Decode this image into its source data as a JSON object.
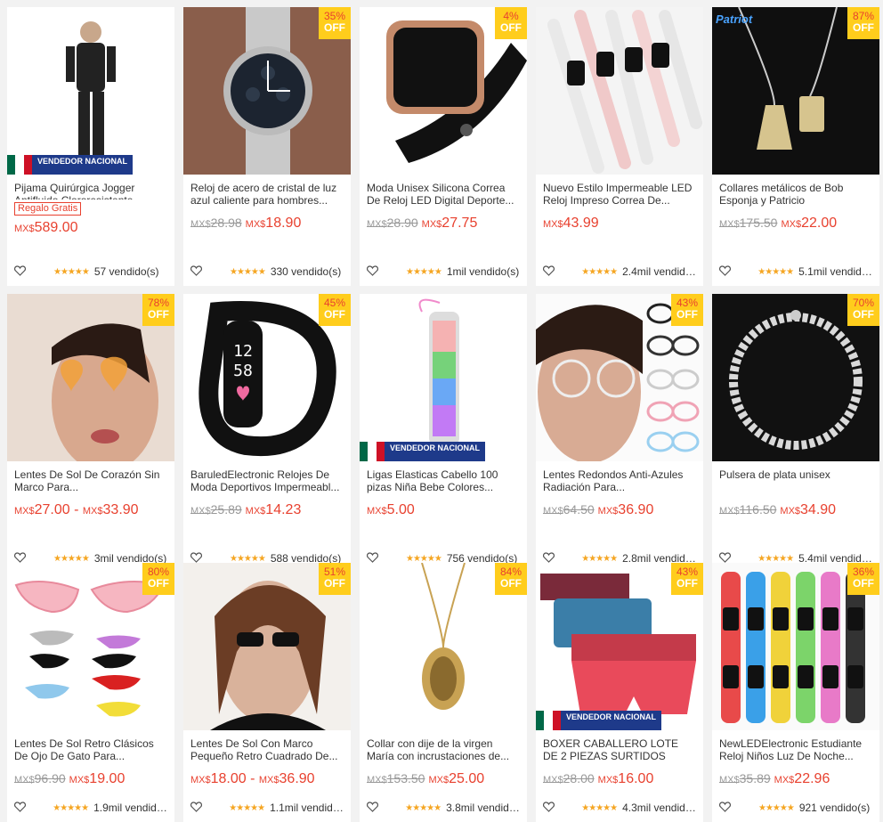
{
  "currency": "MX$",
  "products": [
    {
      "title": "Pijama Quirúrgica Jogger Antifluido Clororesistente...",
      "gift": "Regalo Gratis",
      "old_price": "",
      "price": "589.00",
      "price_max": "",
      "discount": "",
      "vendor": "VENDEDOR NACIONAL",
      "sold": "57 vendido(s)",
      "art": "scrubs"
    },
    {
      "title": "Reloj de acero de cristal de luz azul caliente para hombres...",
      "gift": "",
      "old_price": "28.98",
      "price": "18.90",
      "price_max": "",
      "discount": "35%",
      "vendor": "",
      "sold": "330 vendido(s)",
      "art": "steelwatch"
    },
    {
      "title": "Moda Unisex Silicona Correa De Reloj LED Digital Deporte...",
      "gift": "",
      "old_price": "28.90",
      "price": "27.75",
      "price_max": "",
      "discount": "4%",
      "vendor": "",
      "sold": "1mil vendido(s)",
      "art": "squarewatch"
    },
    {
      "title": "Nuevo Estilo Impermeable LED Reloj Impreso Correa De...",
      "gift": "",
      "old_price": "",
      "price": "43.99",
      "price_max": "",
      "discount": "",
      "vendor": "",
      "sold": "2.4mil vendido...",
      "art": "ledbands"
    },
    {
      "title": "Collares metálicos de Bob Esponja y Patricio",
      "gift": "",
      "old_price": "175.50",
      "price": "22.00",
      "price_max": "",
      "discount": "87%",
      "vendor": "",
      "sold": "5.1mil vendido...",
      "art": "necklaces"
    },
    {
      "title": "Lentes De Sol De Corazón Sin Marco Para...",
      "gift": "",
      "old_price": "",
      "price": "27.00",
      "price_max": "33.90",
      "discount": "78%",
      "vendor": "",
      "sold": "3mil vendido(s)",
      "art": "heartglasses"
    },
    {
      "title": "BaruledElectronic Relojes De Moda Deportivos Impermeabl...",
      "gift": "",
      "old_price": "25.89",
      "price": "14.23",
      "price_max": "",
      "discount": "45%",
      "vendor": "",
      "sold": "588 vendido(s)",
      "art": "blackband"
    },
    {
      "title": "Ligas Elasticas Cabello 100 pizas Niña Bebe Colores...",
      "gift": "",
      "old_price": "",
      "price": "5.00",
      "price_max": "",
      "discount": "",
      "vendor": "VENDEDOR NACIONAL",
      "sold": "756 vendido(s)",
      "art": "hairties"
    },
    {
      "title": "Lentes Redondos Anti-Azules Radiación Para...",
      "gift": "",
      "old_price": "64.50",
      "price": "36.90",
      "price_max": "",
      "discount": "43%",
      "vendor": "",
      "sold": "2.8mil vendido...",
      "art": "roundglasses"
    },
    {
      "title": "Pulsera de plata unisex",
      "gift": "",
      "old_price": "116.50",
      "price": "34.90",
      "price_max": "",
      "discount": "70%",
      "vendor": "",
      "sold": "5.4mil vendido...",
      "art": "bracelet"
    },
    {
      "title": "Lentes De Sol Retro Clásicos De Ojo De Gato Para...",
      "gift": "",
      "old_price": "96.90",
      "price": "19.00",
      "price_max": "",
      "discount": "80%",
      "vendor": "",
      "sold": "1.9mil vendido...",
      "art": "cateye"
    },
    {
      "title": "Lentes De Sol Con Marco Pequeño Retro Cuadrado De...",
      "gift": "",
      "old_price": "",
      "price": "18.00",
      "price_max": "36.90",
      "discount": "51%",
      "vendor": "",
      "sold": "1.1mil vendido...",
      "art": "smallsun"
    },
    {
      "title": "Collar con dije de la virgen María con incrustaciones de...",
      "gift": "",
      "old_price": "153.50",
      "price": "25.00",
      "price_max": "",
      "discount": "84%",
      "vendor": "",
      "sold": "3.8mil vendido...",
      "art": "pendant"
    },
    {
      "title": "BOXER CABALLERO LOTE DE 2 PIEZAS SURTIDOS",
      "gift": "",
      "old_price": "28.00",
      "price": "16.00",
      "price_max": "",
      "discount": "43%",
      "vendor": "VENDEDOR NACIONAL",
      "sold": "4.3mil vendido...",
      "art": "boxers"
    },
    {
      "title": "NewLEDElectronic Estudiante Reloj Niños Luz De Noche...",
      "gift": "",
      "old_price": "35.89",
      "price": "22.96",
      "price_max": "",
      "discount": "36%",
      "vendor": "",
      "sold": "921 vendido(s)",
      "art": "kidswatch"
    }
  ],
  "labels": {
    "off": "OFF",
    "patriot": "Patriot"
  },
  "colors": {
    "accent": "#e8412f",
    "badge": "#ffcd1c",
    "stars": "#f5a623"
  }
}
